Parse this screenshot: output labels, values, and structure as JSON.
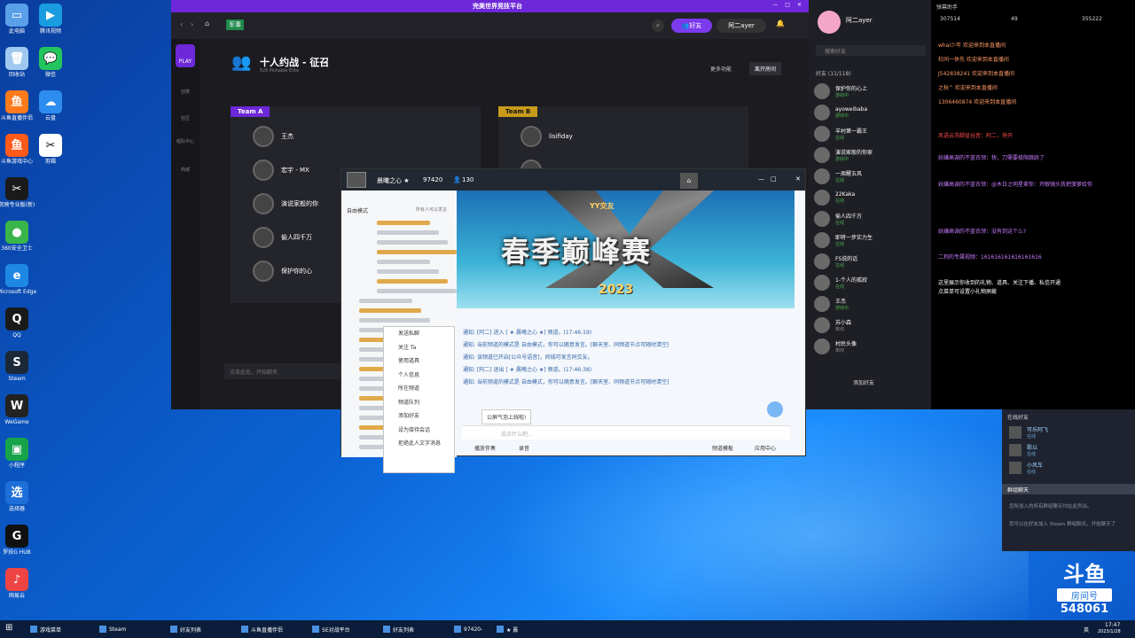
{
  "desktop": {
    "icons": [
      {
        "label": "此电脑",
        "color": "#5aa0e8",
        "glyph": "▭"
      },
      {
        "label": "回收站",
        "color": "#9fc9f0",
        "glyph": "🗑"
      },
      {
        "label": "斗鱼直播伴侣",
        "color": "#ff7a1a",
        "glyph": "鱼"
      },
      {
        "label": "斗鱼游戏中心",
        "color": "#ff5a1a",
        "glyph": "鱼"
      },
      {
        "label": "剪映专业版(新)",
        "color": "#1a1a1a",
        "glyph": "✂"
      },
      {
        "label": "360安全卫士",
        "color": "#3ab54a",
        "glyph": "●"
      },
      {
        "label": "Microsoft Edge",
        "color": "#1e88e5",
        "glyph": "e"
      },
      {
        "label": "QQ",
        "color": "#1a1a1a",
        "glyph": "Q"
      },
      {
        "label": "Steam",
        "color": "#1b2838",
        "glyph": "S"
      },
      {
        "label": "WeGame",
        "color": "#222",
        "glyph": "W"
      },
      {
        "label": "小程序",
        "color": "#16a34a",
        "glyph": "▣"
      },
      {
        "label": "选择器",
        "color": "#1e6fd9",
        "glyph": "选"
      },
      {
        "label": "罗技G HUB",
        "color": "#111",
        "glyph": "G"
      },
      {
        "label": "网易云",
        "color": "#ef4444",
        "glyph": "♪"
      },
      {
        "label": "腾讯视频",
        "color": "#1a9de0",
        "glyph": "▶"
      },
      {
        "label": "微信",
        "color": "#22c55e",
        "glyph": "💬"
      },
      {
        "label": "云盘",
        "color": "#2d8cf0",
        "glyph": "☁"
      },
      {
        "label": "剪辑",
        "color": "#fff",
        "glyph": "✂"
      }
    ]
  },
  "app": {
    "logo": "完美世界竞技平台",
    "nav_tag": "军事",
    "friends_btn": "好友",
    "user": "阿二ayer",
    "play_label": "PLAY",
    "side_items": [
      "创意",
      "社区",
      "组队中心",
      "商城"
    ],
    "page_title": "十人约战 - 征召",
    "page_subtitle": "5v5 Pickable Elite",
    "more_btn": "更多功能",
    "leave_btn": "离开房间",
    "team_a": "Team A",
    "team_b": "Team B",
    "team_a_players": [
      "王杰",
      "宏宇 - MX",
      "演说家般的你",
      "偷人四千万",
      "保护你的心"
    ],
    "team_b_players": [
      "lisifiday",
      ""
    ],
    "chat_placeholder": "点击此处，开始聊天"
  },
  "chat_window": {
    "room_name": "晨曦之心 ★",
    "room_id": "97420",
    "viewers": "130",
    "left_header": "自由模式",
    "left_header_right": "所有人可以发言",
    "banner_title": "春季巅峰赛",
    "banner_year": "2023",
    "banner_brand": "YY交友",
    "messages": [
      "通知: [阿二] 进入 [    ★ 晨曦之心 ★] 频道。(17:46:19)",
      "通知: 当前频道的模式是 自由模式，你可以随意发言。[聊天室、同频道节点可随时清空]",
      "通知: 该频道已开启[公众号语音]，同城可发言同交友。",
      "通知: [阿二] 退出 [    ★ 晨曦之心 ★] 频道。(17:46:38)",
      "通知: 当前频道的模式是 自由模式，你可以随意发言。[聊天室、同频道节点可随时清空]"
    ],
    "bubble": "公屏气泡上线啦!",
    "input_placeholder": "说点什么吧...",
    "bottom_left": "播放伴奏",
    "bottom_left2": "录音",
    "bottom_right": "频道模板",
    "bottom_right2": "应用中心"
  },
  "context_menu": [
    "发送私聊",
    "关注 Ta",
    "使用道具",
    "个人信息",
    "所在频道",
    "频道队列",
    "添加好友",
    "设为接待会话",
    "拒绝此人文字消息"
  ],
  "friends_panel": {
    "user": "阿二ayer",
    "search": "搜索好友",
    "group": "好友 (11/118)",
    "friends": [
      {
        "name": "保护你的心上",
        "status": "游戏中"
      },
      {
        "name": "ayoweibaba",
        "status": "游戏中"
      },
      {
        "name": "羊村第一霸王",
        "status": "在线"
      },
      {
        "name": "演说家般的你家",
        "status": "游戏中"
      },
      {
        "name": "一周醒五风",
        "status": "在线"
      },
      {
        "name": "22Kaka",
        "status": "在线"
      },
      {
        "name": "偷人四千万",
        "status": "在线"
      },
      {
        "name": "即将一步实力生",
        "status": "在线"
      },
      {
        "name": "FS说的话",
        "status": "在线"
      },
      {
        "name": "1-个人的孤寂",
        "status": "在线"
      },
      {
        "name": "王杰",
        "status": "游戏中"
      },
      {
        "name": "苏小森",
        "status": "离线"
      },
      {
        "name": "村民头像",
        "status": "离线"
      }
    ],
    "add_friend": "添加好友"
  },
  "stream": {
    "header": "弹幕助手",
    "stats": [
      "307514",
      "49",
      "355222"
    ],
    "lines": [
      {
        "text": "whai少年 欢迎来到本直播间",
        "color": "#ff9966"
      },
      {
        "text": "杜同一休先 欢迎来到本直播间",
        "color": "#ff9966"
      },
      {
        "text": "J542838241 欢迎来到本直播间",
        "color": "#ff9966"
      },
      {
        "text": "之秋^ 欢迎来到本直播间",
        "color": "#ff9966"
      },
      {
        "text": "1306460874 欢迎来到本直播间",
        "color": "#ff9966"
      },
      {
        "text": "风语云洗脚盆谷音：阿二，快开",
        "color": "#ff4d4d"
      },
      {
        "text": "妖嫌高调的不蓝衣领：快，刀需要极限跳跃了",
        "color": "#c77dff"
      },
      {
        "text": "妖嫌高调的不蓝衣领：@木日之明星辈你：开眼镜头我把菠萝给你",
        "color": "#c77dff"
      },
      {
        "text": "妖嫌高调的不蓝衣领：没有到这个么?",
        "color": "#c77dff"
      },
      {
        "text": "二狗的专属视频：161616161616161616",
        "color": "#c77dff"
      },
      {
        "text": "这里展示你收到的礼物、道具、关注下播、私信开通",
        "color": "#ffffff"
      },
      {
        "text": "点菜单可设置小礼物屏蔽",
        "color": "#ffffff"
      }
    ]
  },
  "steam": {
    "online_header": "在线好友",
    "friends": [
      {
        "name": "可乐阿飞",
        "status": "在线"
      },
      {
        "name": "歌以",
        "status": "在线"
      },
      {
        "name": "小风车",
        "status": "在线"
      }
    ],
    "group_header": "群组聊天",
    "group_text": "您所加入的所有群组聊天均在此列出。",
    "group_text2": "您可以在好友加入 Steam 群组聊天。开始聊天了"
  },
  "watermark": {
    "brand": "斗鱼",
    "sub": "房间号",
    "room": "548061"
  },
  "taskbar": {
    "items": [
      "游戏菜单",
      "Steam",
      "好友列表",
      "斗鱼直播伴侣",
      "5E对战平台",
      "好友列表",
      "97420-",
      "★ 晨"
    ],
    "time": "17:47",
    "date": "2023/1/28",
    "lang": "英"
  }
}
